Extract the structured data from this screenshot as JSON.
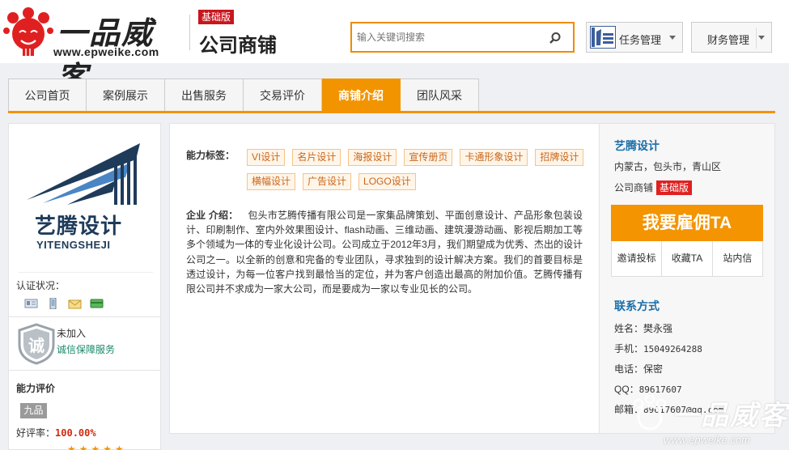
{
  "header": {
    "logo_text": "一品威客",
    "logo_url": "www.epweike.com",
    "edition_badge": "基础版",
    "shop_title": "公司商铺",
    "search": {
      "placeholder": "输入关键词搜索"
    },
    "task_menu": {
      "label": "任务管理",
      "logo_text": "艺腾设计"
    },
    "finance_menu": {
      "label": "财务管理"
    }
  },
  "nav": {
    "tabs": [
      {
        "label": "公司首页",
        "active": false
      },
      {
        "label": "案例展示",
        "active": false
      },
      {
        "label": "出售服务",
        "active": false
      },
      {
        "label": "交易评价",
        "active": false
      },
      {
        "label": "商铺介绍",
        "active": true
      },
      {
        "label": "团队风采",
        "active": false
      }
    ]
  },
  "sidebar": {
    "company_brand": "艺腾设计",
    "company_pinyin": "YITENGSHEJI",
    "cert_label": "认证状况：",
    "trust_status": "未加入",
    "trust_link": "诚信保障服务",
    "shield_char": "诚",
    "ability_title": "能力评价",
    "level": "九品",
    "rate_label": "好评率：",
    "rate_value": "100.00%",
    "stars": "★★★★★"
  },
  "main": {
    "tags_label": "能力标签：",
    "tags": [
      "VI设计",
      "名片设计",
      "海报设计",
      "宣传册页",
      "卡通形象设计",
      "招牌设计",
      "横幅设计",
      "广告设计",
      "LOGO设计"
    ],
    "intro_label": "企业 介绍：",
    "intro_text": "包头市艺腾传播有限公司是一家集品牌策划、平面创意设计、产品形象包装设计、印刷制作、室内外效果图设计、flash动画、三维动画、建筑漫游动画、影视后期加工等多个领域为一体的专业化设计公司。公司成立于2012年3月，我们期望成为优秀、杰出的设计公司之一。以全新的创意和完备的专业团队，寻求独到的设计解决方案。我们的首要目标是透过设计，为每一位客户找到最恰当的定位，并为客户创造出最高的附加价值。艺腾传播有限公司并不求成为一家大公司，而是要成为一家以专业见长的公司。"
  },
  "right": {
    "shop_name": "艺腾设计",
    "location": "内蒙古，包头市，青山区",
    "shop_type": "公司商铺",
    "shop_type_badge": "基础版",
    "hire_button": "我要雇佣TA",
    "actions": [
      "邀请投标",
      "收藏TA",
      "站内信"
    ],
    "contact_title": "联系方式",
    "contacts": [
      {
        "label": "姓名：",
        "value": "樊永强"
      },
      {
        "label": "手机：",
        "value": "15049264288"
      },
      {
        "label": "电话：",
        "value": "保密"
      },
      {
        "label": "QQ：",
        "value": "89617607"
      },
      {
        "label": "邮箱：",
        "value": "89617607@qq.com"
      }
    ]
  },
  "watermark": {
    "text": "一品威客",
    "url": "www.epweike.com"
  },
  "colors": {
    "accent": "#f29400",
    "brand_red": "#c8161d",
    "link_blue": "#1a6ea8"
  }
}
